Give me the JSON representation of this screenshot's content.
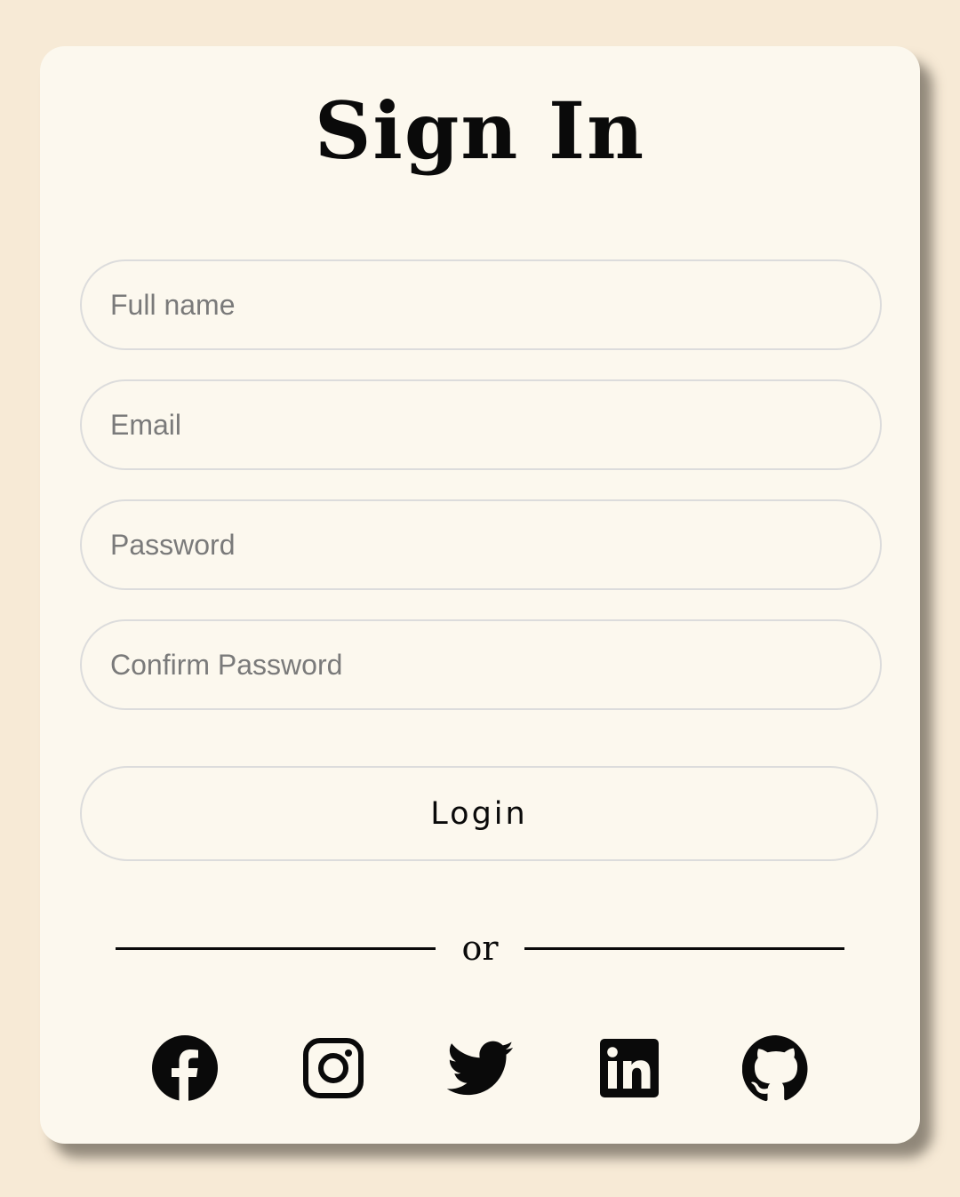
{
  "form": {
    "title": "Sign In",
    "fields": [
      {
        "name": "full-name",
        "placeholder": "Full name",
        "value": ""
      },
      {
        "name": "email",
        "placeholder": "Email",
        "value": ""
      },
      {
        "name": "password",
        "placeholder": "Password",
        "value": ""
      },
      {
        "name": "confirm-password",
        "placeholder": "Confirm Password",
        "value": ""
      }
    ],
    "login_label": "Login",
    "divider_text": "or"
  },
  "social": [
    {
      "icon": "facebook-icon"
    },
    {
      "icon": "instagram-icon"
    },
    {
      "icon": "twitter-icon"
    },
    {
      "icon": "linkedin-icon"
    },
    {
      "icon": "github-icon"
    }
  ],
  "colors": {
    "page_background": "#f7ead6",
    "card_background": "#fcf8ee",
    "border": "#dcdcdc",
    "text": "#0a0a0a",
    "placeholder": "#7a7a7a"
  }
}
